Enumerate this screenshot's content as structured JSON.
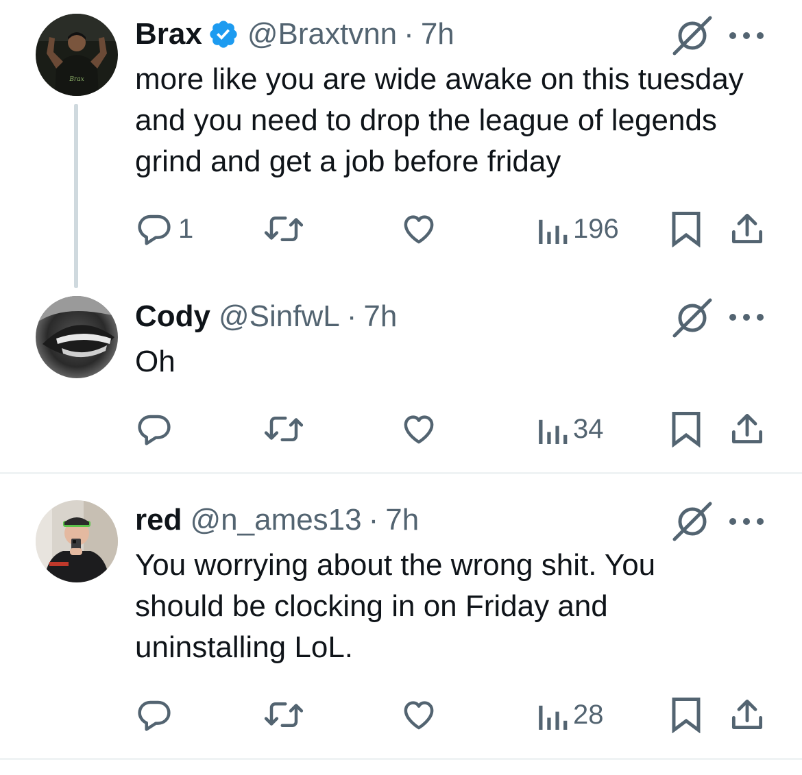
{
  "tweets": [
    {
      "name": "Brax",
      "verified": true,
      "handle": "@Braxtvnn",
      "separator": "·",
      "time": "7h",
      "text": "more like you are wide awake on this tuesday and you need to drop the league of legends grind and get a job before friday",
      "replies": "1",
      "views": "196",
      "avatar_text": "Brax"
    },
    {
      "name": "Cody",
      "verified": false,
      "handle": "@SinfwL",
      "separator": "·",
      "time": "7h",
      "text": "Oh",
      "replies": "",
      "views": "34"
    },
    {
      "name": "red",
      "verified": false,
      "handle": "@n_ames13",
      "separator": "·",
      "time": "7h",
      "text": "You worrying about the wrong shit. You should be clocking in on Friday and uninstalling LoL.",
      "replies": "",
      "views": "28"
    }
  ],
  "icons": {
    "reply": "reply-icon",
    "retweet": "retweet-icon",
    "like": "heart-icon",
    "views": "views-chart-icon",
    "bookmark": "bookmark-icon",
    "share": "share-icon",
    "grok": "grok-icon",
    "more": "more-dots-icon",
    "verified": "verified-badge-icon"
  },
  "colors": {
    "text": "#0f1419",
    "secondary": "#536471",
    "verified": "#1d9bf0",
    "thread_line": "#cfd9de",
    "divider": "#eff3f4"
  }
}
